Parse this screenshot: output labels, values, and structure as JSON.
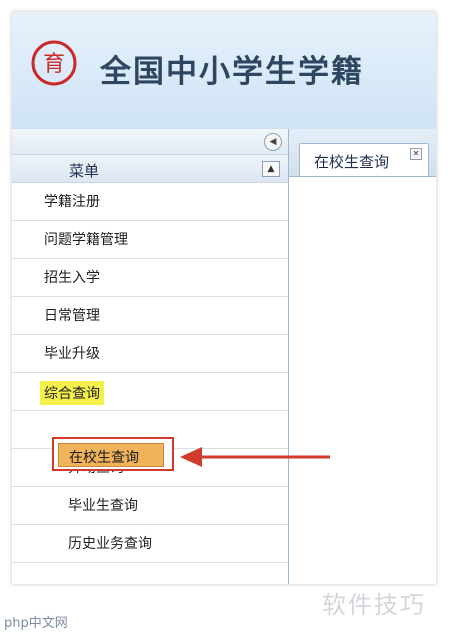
{
  "banner": {
    "title": "全国中小学生学籍",
    "logo_text": "育"
  },
  "sidebar": {
    "menu_title": "菜单",
    "items": [
      {
        "label": "学籍注册"
      },
      {
        "label": "问题学籍管理"
      },
      {
        "label": "招生入学"
      },
      {
        "label": "日常管理"
      },
      {
        "label": "毕业升级"
      },
      {
        "label": "综合查询"
      }
    ],
    "subitems": [
      {
        "label": "在校生查询"
      },
      {
        "label": "异动查询"
      },
      {
        "label": "毕业生查询"
      },
      {
        "label": "历史业务查询"
      }
    ]
  },
  "tabs": [
    {
      "label": "在校生查询"
    }
  ],
  "watermarks": {
    "left": "php中文网",
    "right": "软件技巧"
  },
  "colors": {
    "accent": "#d23a2c",
    "selected": "#f0b25a",
    "highlight": "#f6f04a"
  }
}
